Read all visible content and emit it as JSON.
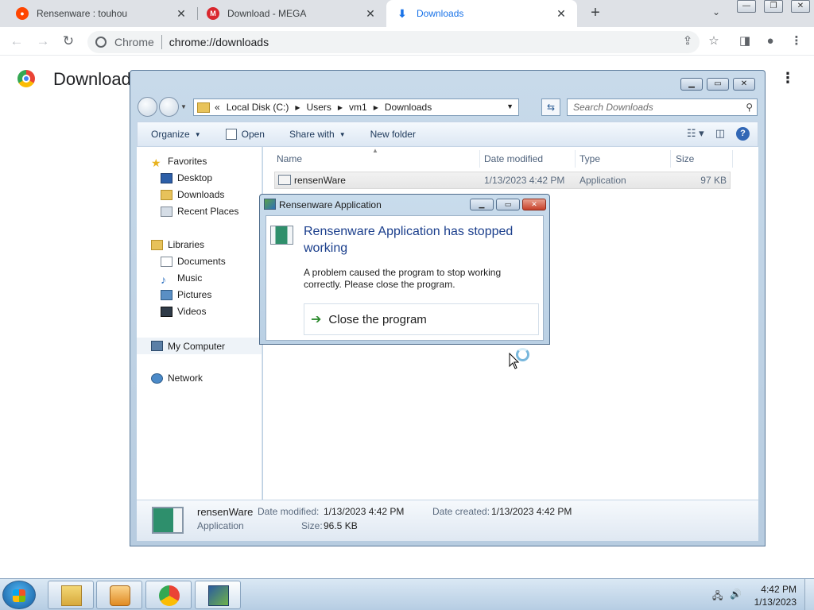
{
  "chrome": {
    "tabs": [
      {
        "title": "Rensenware : touhou",
        "icon": "reddit-icon",
        "color": "#ff4500"
      },
      {
        "title": "Download - MEGA",
        "icon": "mega-icon",
        "color": "#d9272e"
      },
      {
        "title": "Downloads",
        "icon": "download-icon",
        "color": "#1a73e8"
      }
    ],
    "new_tab": "+",
    "chip": "Chrome",
    "url": "chrome://downloads",
    "page_title": "Download"
  },
  "explorer": {
    "address": {
      "root": "Local Disk (C:)",
      "crumbs": [
        "Users",
        "vm1",
        "Downloads"
      ]
    },
    "search_placeholder": "Search Downloads",
    "commands": {
      "organize": "Organize",
      "open": "Open",
      "share": "Share with",
      "new_folder": "New folder"
    },
    "nav": {
      "favorites": "Favorites",
      "desktop": "Desktop",
      "downloads": "Downloads",
      "recent": "Recent Places",
      "libraries": "Libraries",
      "documents": "Documents",
      "music": "Music",
      "pictures": "Pictures",
      "videos": "Videos",
      "computer": "My Computer",
      "network": "Network"
    },
    "columns": {
      "name": "Name",
      "date": "Date modified",
      "type": "Type",
      "size": "Size"
    },
    "files": [
      {
        "name": "rensenWare",
        "date": "1/13/2023 4:42 PM",
        "type": "Application",
        "size": "97 KB"
      }
    ],
    "details": {
      "name": "rensenWare",
      "type": "Application",
      "modified_label": "Date modified:",
      "modified": "1/13/2023 4:42 PM",
      "size_label": "Size:",
      "size": "96.5 KB",
      "created_label": "Date created:",
      "created": "1/13/2023 4:42 PM"
    }
  },
  "dialog": {
    "title": "Rensenware Application",
    "heading": "Rensenware Application has stopped working",
    "message": "A problem caused the program to stop working correctly. Please close the program.",
    "button": "Close the program"
  },
  "taskbar": {
    "time": "4:42 PM",
    "date": "1/13/2023"
  }
}
